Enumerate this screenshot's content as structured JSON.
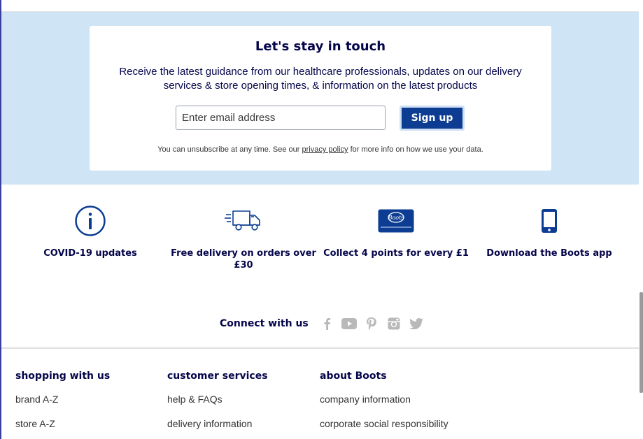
{
  "newsletter": {
    "title": "Let's stay in touch",
    "description": "Receive the latest guidance from our healthcare professionals, updates on our delivery services & store opening times, & information on the latest products",
    "email_placeholder": "Enter email address",
    "signup_label": "Sign up",
    "note_before": "You can unsubscribe at any time. See our ",
    "note_link": "privacy policy",
    "note_after": " for more info on how we use your data."
  },
  "benefits": [
    {
      "icon": "info-icon",
      "label": "COVID-19 updates"
    },
    {
      "icon": "delivery-truck-icon",
      "label": "Free delivery on orders over £30"
    },
    {
      "icon": "advantage-card-icon",
      "label": "Collect 4 points for every £1",
      "card_text": "Boots"
    },
    {
      "icon": "mobile-phone-icon",
      "label": "Download the Boots app"
    }
  ],
  "connect": {
    "title": "Connect with us",
    "social": [
      "facebook-icon",
      "youtube-icon",
      "pinterest-icon",
      "instagram-icon",
      "twitter-icon"
    ]
  },
  "footer": {
    "columns": [
      {
        "heading": "shopping with us",
        "links": [
          "brand A-Z",
          "store A-Z"
        ]
      },
      {
        "heading": "customer services",
        "links": [
          "help & FAQs",
          "delivery information"
        ]
      },
      {
        "heading": "about Boots",
        "links": [
          "company information",
          "corporate social responsibility"
        ]
      }
    ]
  },
  "colors": {
    "navy": "#05054b",
    "band": "#cfe4f4",
    "button": "#0d3d92",
    "icon_blue": "#0d3d92",
    "social_grey": "#b9b9b9"
  }
}
